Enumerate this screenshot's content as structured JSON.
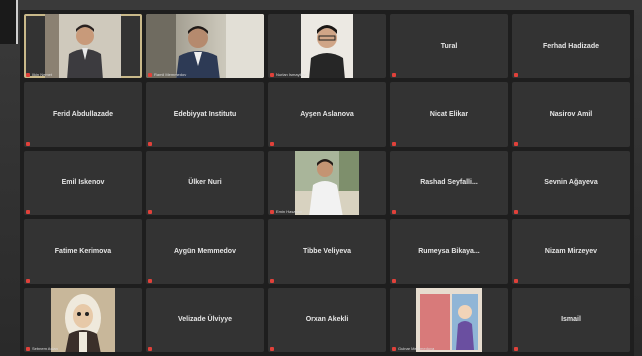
{
  "tiles": [
    {
      "id": "t1",
      "label": "Ilkin Nemet",
      "video": true,
      "active": true
    },
    {
      "id": "t2",
      "label": "Ramil Memmedov",
      "video": true
    },
    {
      "id": "t3",
      "label": "Nurlan Ismayilov",
      "video": true
    },
    {
      "id": "t4",
      "label": "Tural",
      "video": false
    },
    {
      "id": "t5",
      "label": "Ferhad Hadizade",
      "video": false
    },
    {
      "id": "t6",
      "label": "Ferid Abdullazade",
      "video": false
    },
    {
      "id": "t7",
      "label": "Edebiyyat Institutu",
      "video": false
    },
    {
      "id": "t8",
      "label": "Ayşen Aslanova",
      "video": false
    },
    {
      "id": "t9",
      "label": "Nicat Elikar",
      "video": false
    },
    {
      "id": "t10",
      "label": "Nasirov Amil",
      "video": false
    },
    {
      "id": "t11",
      "label": "Emil Iskenov",
      "video": false
    },
    {
      "id": "t12",
      "label": "Ülker Nuri",
      "video": false
    },
    {
      "id": "t13",
      "label": "Emin Hasanov",
      "video": true
    },
    {
      "id": "t14",
      "label": "Rashad Seyfalli...",
      "video": false
    },
    {
      "id": "t15",
      "label": "Sevnin Ağayeva",
      "video": false
    },
    {
      "id": "t16",
      "label": "Fatime Kerimova",
      "video": false
    },
    {
      "id": "t17",
      "label": "Aygün Memmedov",
      "video": false
    },
    {
      "id": "t18",
      "label": "Tibbe Veliyeva",
      "video": false
    },
    {
      "id": "t19",
      "label": "Rumeysa Bikaya...",
      "video": false
    },
    {
      "id": "t20",
      "label": "Nizam Mirzeyev",
      "video": false
    },
    {
      "id": "t21",
      "label": "Sebnem Aslan",
      "video": true
    },
    {
      "id": "t22",
      "label": "Velizade Ülviyye",
      "video": false
    },
    {
      "id": "t23",
      "label": "Orxan Akekli",
      "video": false
    },
    {
      "id": "t24",
      "label": "Gulnar Memmedova",
      "video": true
    },
    {
      "id": "t25",
      "label": "Ismail",
      "video": false
    }
  ],
  "colors": {
    "tile": "#333333",
    "mic_muted": "#e0413a",
    "active_border": "#c9b98a"
  }
}
